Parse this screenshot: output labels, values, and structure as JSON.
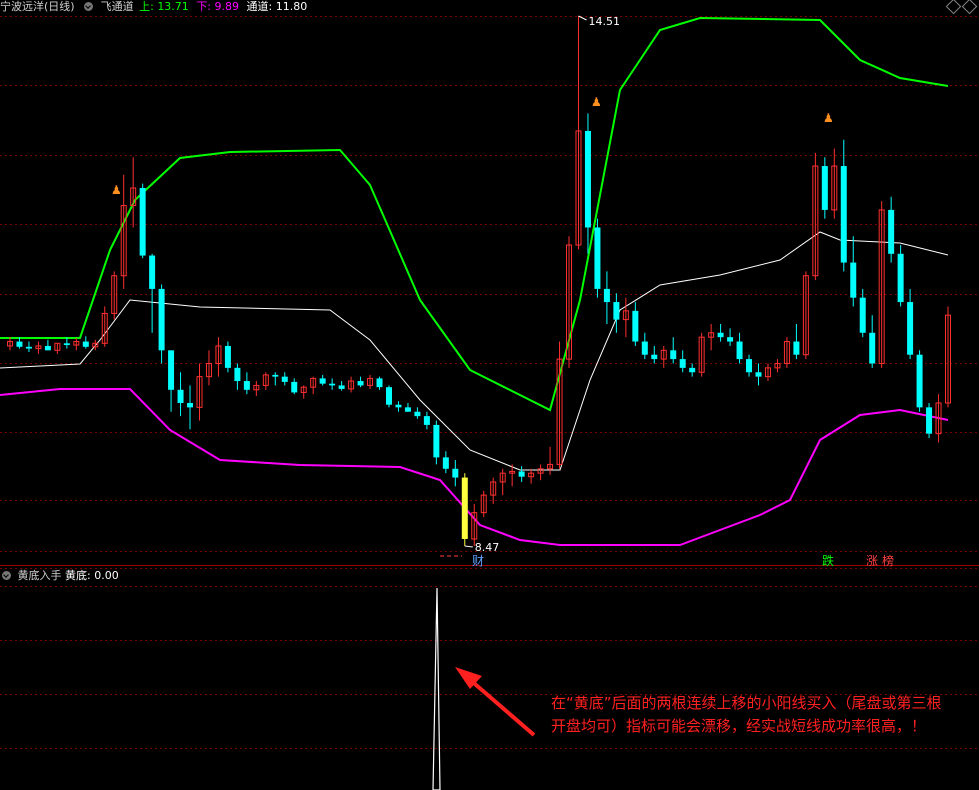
{
  "header": {
    "stock_title": "宁波远洋(日线)",
    "indicator_name": "飞通道",
    "upper_label": "上:",
    "upper_value": "13.71",
    "lower_label": "下:",
    "lower_value": "9.89",
    "channel_label": "通道:",
    "channel_value": "11.80"
  },
  "colors": {
    "upper": "#00ff00",
    "lower": "#ff00ff",
    "mid": "#ffffff",
    "up_candle": "#ff3030",
    "down_candle": "#00ffff",
    "signal_candle": "#ffff40",
    "annotation": "#ff2020",
    "grid": "#7a0000"
  },
  "subpanel": {
    "indicator_name": "黄底入手",
    "value_label": "黄底:",
    "value": "0.00"
  },
  "annotation_text": "在“黄底”后面的两根连续上移的小阳线买入（尾盘或第三根开盘均可）指标可能会漂移，经实战短线成功率很高，！",
  "chart_data": [
    {
      "type": "candlestick",
      "title": "宁波远洋(日线)",
      "x_index": [
        0,
        1,
        2,
        3,
        4,
        5,
        6,
        7,
        8,
        9,
        10,
        11,
        12,
        13,
        14,
        15,
        16,
        17,
        18,
        19,
        20,
        21,
        22,
        23,
        24,
        25,
        26,
        27,
        28,
        29,
        30,
        31,
        32,
        33,
        34,
        35,
        36,
        37,
        38,
        39,
        40,
        41,
        42,
        43,
        44,
        45,
        46,
        47,
        48,
        49,
        50,
        51,
        52,
        53,
        54,
        55,
        55,
        56,
        57,
        58,
        59,
        60,
        61,
        62,
        63,
        64,
        65,
        66,
        67,
        68,
        69,
        70,
        71,
        72,
        73,
        74,
        75,
        76,
        77,
        78,
        79,
        80,
        81,
        82,
        83,
        84,
        85,
        86,
        87,
        88,
        89,
        90,
        91,
        92,
        93,
        94,
        95,
        96,
        97,
        98,
        99,
        100,
        101,
        102,
        103,
        104,
        105,
        106,
        107,
        108,
        109,
        110,
        111,
        112,
        113,
        114,
        115,
        116,
        117,
        118
      ],
      "ohlc_note": "Prices read off the chart; units are yuan.",
      "candles": [
        [
          10.75,
          10.85,
          10.7,
          10.8
        ],
        [
          10.8,
          10.85,
          10.72,
          10.74
        ],
        [
          10.74,
          10.8,
          10.68,
          10.72
        ],
        [
          10.72,
          10.8,
          10.66,
          10.75
        ],
        [
          10.75,
          10.82,
          10.7,
          10.7
        ],
        [
          10.7,
          10.78,
          10.66,
          10.78
        ],
        [
          10.78,
          10.85,
          10.72,
          10.76
        ],
        [
          10.76,
          10.84,
          10.7,
          10.8
        ],
        [
          10.8,
          10.86,
          10.72,
          10.74
        ],
        [
          10.74,
          10.82,
          10.7,
          10.78
        ],
        [
          10.78,
          11.2,
          10.74,
          11.12
        ],
        [
          11.12,
          11.6,
          11.05,
          11.55
        ],
        [
          11.55,
          12.7,
          11.4,
          12.35
        ],
        [
          12.35,
          12.9,
          12.1,
          12.55
        ],
        [
          12.55,
          12.6,
          11.75,
          11.78
        ],
        [
          11.78,
          11.8,
          10.9,
          11.4
        ],
        [
          11.4,
          11.45,
          10.55,
          10.7
        ],
        [
          10.7,
          10.7,
          10.0,
          10.25
        ],
        [
          10.25,
          10.45,
          9.95,
          10.1
        ],
        [
          10.1,
          10.3,
          9.8,
          10.05
        ],
        [
          10.05,
          10.55,
          9.9,
          10.4
        ],
        [
          10.4,
          10.7,
          10.3,
          10.55
        ],
        [
          10.55,
          10.85,
          10.4,
          10.75
        ],
        [
          10.75,
          10.8,
          10.45,
          10.5
        ],
        [
          10.5,
          10.55,
          10.25,
          10.35
        ],
        [
          10.35,
          10.45,
          10.2,
          10.25
        ],
        [
          10.25,
          10.35,
          10.18,
          10.3
        ],
        [
          10.3,
          10.45,
          10.25,
          10.42
        ],
        [
          10.42,
          10.45,
          10.3,
          10.4
        ],
        [
          10.4,
          10.45,
          10.3,
          10.34
        ],
        [
          10.34,
          10.38,
          10.2,
          10.22
        ],
        [
          10.22,
          10.3,
          10.15,
          10.28
        ],
        [
          10.28,
          10.4,
          10.2,
          10.38
        ],
        [
          10.38,
          10.42,
          10.3,
          10.32
        ],
        [
          10.32,
          10.38,
          10.25,
          10.3
        ],
        [
          10.3,
          10.35,
          10.24,
          10.26
        ],
        [
          10.26,
          10.4,
          10.22,
          10.35
        ],
        [
          10.35,
          10.4,
          10.28,
          10.3
        ],
        [
          10.3,
          10.42,
          10.26,
          10.38
        ],
        [
          10.38,
          10.4,
          10.25,
          10.28
        ],
        [
          10.28,
          10.3,
          10.05,
          10.08
        ],
        [
          10.08,
          10.12,
          10.0,
          10.05
        ],
        [
          10.05,
          10.1,
          10.0,
          10.0
        ],
        [
          10.0,
          10.05,
          9.92,
          9.95
        ],
        [
          9.95,
          10.0,
          9.8,
          9.85
        ],
        [
          9.85,
          9.9,
          9.4,
          9.48
        ],
        [
          9.48,
          9.55,
          9.3,
          9.35
        ],
        [
          9.35,
          9.45,
          9.15,
          9.25
        ],
        [
          9.25,
          9.3,
          8.47,
          8.55
        ],
        [
          8.55,
          8.95,
          8.47,
          8.85
        ],
        [
          8.85,
          9.1,
          8.8,
          9.05
        ],
        [
          9.05,
          9.25,
          8.95,
          9.2
        ],
        [
          9.2,
          9.35,
          9.05,
          9.3
        ],
        [
          9.3,
          9.4,
          9.15,
          9.32
        ],
        [
          9.32,
          9.38,
          9.2,
          9.26
        ],
        [
          9.26,
          9.35,
          9.18,
          9.3
        ],
        [
          9.3,
          9.4,
          9.22,
          9.35
        ],
        [
          9.35,
          9.6,
          9.28,
          9.4
        ],
        [
          9.4,
          10.8,
          9.35,
          10.6
        ],
        [
          10.6,
          12.0,
          10.5,
          11.9
        ],
        [
          11.9,
          14.51,
          11.85,
          13.2
        ],
        [
          13.2,
          13.4,
          11.8,
          12.1
        ],
        [
          12.1,
          12.2,
          11.3,
          11.4
        ],
        [
          11.4,
          11.6,
          11.0,
          11.25
        ],
        [
          11.25,
          11.35,
          10.9,
          11.05
        ],
        [
          11.05,
          11.3,
          10.85,
          11.15
        ],
        [
          11.15,
          11.25,
          10.75,
          10.8
        ],
        [
          10.8,
          10.9,
          10.6,
          10.65
        ],
        [
          10.65,
          10.75,
          10.55,
          10.6
        ],
        [
          10.6,
          10.75,
          10.5,
          10.7
        ],
        [
          10.7,
          10.85,
          10.55,
          10.6
        ],
        [
          10.6,
          10.7,
          10.45,
          10.5
        ],
        [
          10.5,
          10.55,
          10.4,
          10.45
        ],
        [
          10.45,
          10.9,
          10.4,
          10.85
        ],
        [
          10.85,
          11.0,
          10.7,
          10.9
        ],
        [
          10.9,
          11.0,
          10.8,
          10.85
        ],
        [
          10.85,
          10.95,
          10.75,
          10.8
        ],
        [
          10.8,
          10.9,
          10.55,
          10.6
        ],
        [
          10.6,
          10.65,
          10.4,
          10.45
        ],
        [
          10.45,
          10.55,
          10.3,
          10.4
        ],
        [
          10.4,
          10.55,
          10.35,
          10.5
        ],
        [
          10.5,
          10.6,
          10.45,
          10.55
        ],
        [
          10.55,
          10.85,
          10.5,
          10.8
        ],
        [
          10.8,
          11.0,
          10.6,
          10.65
        ],
        [
          10.65,
          11.6,
          10.6,
          11.55
        ],
        [
          11.55,
          12.95,
          11.5,
          12.8
        ],
        [
          12.8,
          12.9,
          12.2,
          12.3
        ],
        [
          12.3,
          13.0,
          12.2,
          12.8
        ],
        [
          12.8,
          13.1,
          11.6,
          11.7
        ],
        [
          11.7,
          12.0,
          11.2,
          11.3
        ],
        [
          11.3,
          11.4,
          10.85,
          10.9
        ],
        [
          10.9,
          11.1,
          10.5,
          10.55
        ],
        [
          10.55,
          12.4,
          10.5,
          12.3
        ],
        [
          12.3,
          12.45,
          11.7,
          11.8
        ],
        [
          11.8,
          11.9,
          11.2,
          11.25
        ],
        [
          11.25,
          11.4,
          10.6,
          10.65
        ],
        [
          10.65,
          10.7,
          10.0,
          10.05
        ],
        [
          10.05,
          10.1,
          9.7,
          9.75
        ],
        [
          9.75,
          10.2,
          9.65,
          10.1
        ],
        [
          10.1,
          11.2,
          10.05,
          11.1
        ]
      ],
      "upper_channel_label": "上",
      "upper_channel_last": 13.71,
      "lower_channel_label": "下",
      "lower_channel_last": 9.89,
      "mid_channel_label": "通道",
      "mid_channel_last": 11.8,
      "annotations": [
        "14.51",
        "8.47",
        "财",
        "跌",
        "涨",
        "榜"
      ]
    },
    {
      "type": "line",
      "title": "黄底入手",
      "series": [
        {
          "name": "黄底",
          "values": [
            0,
            0,
            0,
            0,
            0,
            0,
            0,
            0,
            0,
            0,
            1,
            0,
            0,
            0,
            0,
            0,
            0,
            0,
            0,
            0
          ]
        }
      ],
      "last_value": 0.0
    }
  ]
}
